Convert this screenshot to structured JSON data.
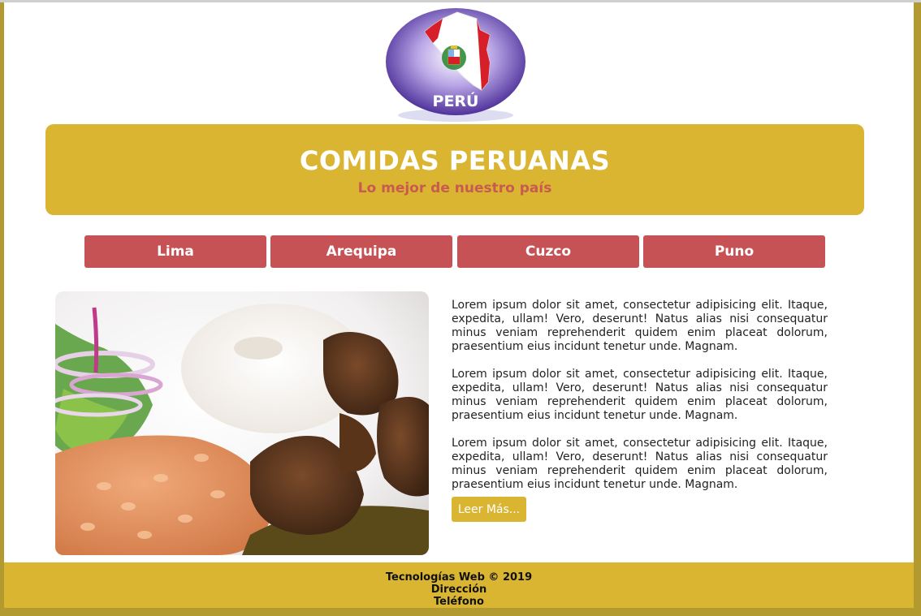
{
  "logo": {
    "text": "PERÚ"
  },
  "banner": {
    "title": "COMIDAS PERUANAS",
    "subtitle": "Lo mejor de nuestro país"
  },
  "nav": {
    "items": [
      {
        "label": "Lima"
      },
      {
        "label": "Arequipa"
      },
      {
        "label": "Cuzco"
      },
      {
        "label": "Puno"
      }
    ]
  },
  "content": {
    "paragraphs": [
      "Lorem ipsum dolor sit amet, consectetur adipisicing elit. Itaque, expedita, ullam! Vero, deserunt! Natus alias nisi consequatur minus veniam reprehenderit quidem enim placeat dolorum, praesentium eius incidunt tenetur unde. Magnam.",
      "Lorem ipsum dolor sit amet, consectetur adipisicing elit. Itaque, expedita, ullam! Vero, deserunt! Natus alias nisi consequatur minus veniam reprehenderit quidem enim placeat dolorum, praesentium eius incidunt tenetur unde. Magnam.",
      "Lorem ipsum dolor sit amet, consectetur adipisicing elit. Itaque, expedita, ullam! Vero, deserunt! Natus alias nisi consequatur minus veniam reprehenderit quidem enim placeat dolorum, praesentium eius incidunt tenetur unde. Magnam."
    ],
    "read_more": "Leer Más..."
  },
  "footer": {
    "line1": "Tecnologías Web © 2019",
    "line2": "Dirección",
    "line3": "Teléfono"
  },
  "colors": {
    "accent": "#dab532",
    "nav": "#c75256",
    "frame": "#b39a30"
  }
}
